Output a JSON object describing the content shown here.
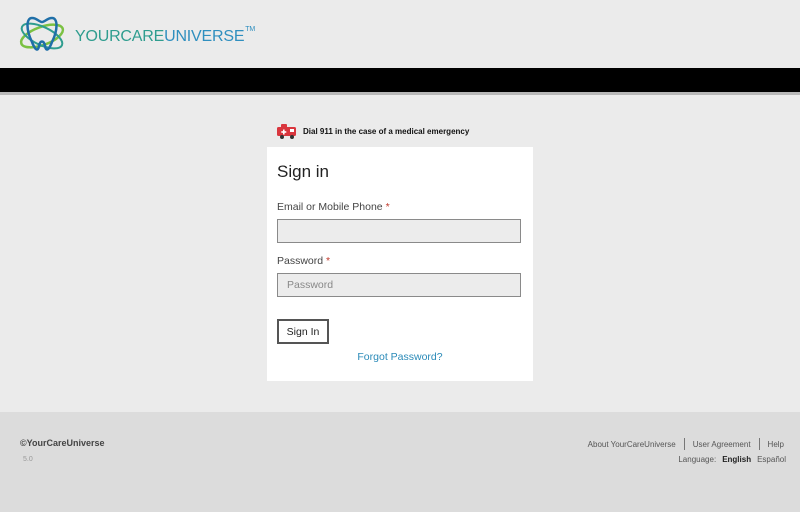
{
  "brand": {
    "part1": "YOURCARE",
    "part2": "UNIVERSE",
    "trademark": "TM",
    "colors": {
      "teal": "#2f9d8f",
      "blue": "#2f8fbf"
    }
  },
  "notice": {
    "icon": "ambulance-icon",
    "text": "Dial 911 in the case of a medical emergency",
    "icon_color": "#d9363e"
  },
  "signin": {
    "title": "Sign in",
    "email_label": "Email or Mobile Phone",
    "email_value": "",
    "required_mark": "*",
    "password_label": "Password",
    "password_placeholder": "Password",
    "submit_label": "Sign In",
    "forgot_label": "Forgot Password?",
    "link_color": "#2a8ab8"
  },
  "footer": {
    "copyright": "©YourCareUniverse",
    "version": "5.0",
    "links": [
      "About YourCareUniverse",
      "User Agreement",
      "Help"
    ],
    "language_label": "Language:",
    "language_current": "English",
    "language_other": "Español"
  }
}
